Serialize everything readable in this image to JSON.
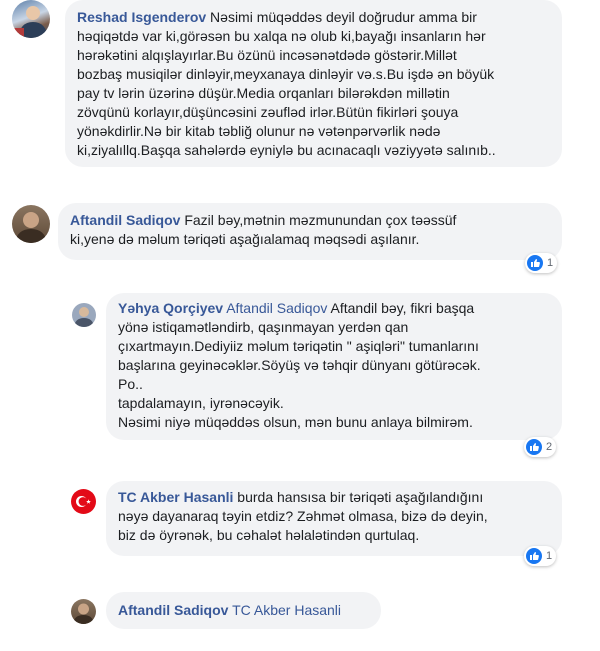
{
  "comments": [
    {
      "author": "Reshad Isgenderov",
      "mention": "",
      "lines": [
        "Nəsimi müqəddəs deyil doğrudur amma bir",
        "həqiqətdə var ki,görəsən bu xalqa nə olub ki,bayağı insanların hər",
        "hərəkətini alqışlayırlar.Bu özünü incəsənətdədə göstərir.Millət",
        "bozbaş musiqilər dinləyir,meyxanaya dinləyir və.s.Bu işdə ən böyük",
        "pay tv lərin üzərinə düşür.Media orqanları bilərəkdən millətin",
        "zövqünü korlayır,düşüncəsini zəufləd irlər.Bütün fikirləri şouya",
        "yönəkdirlir.Nə bir kitab təbliğ olunur nə vətənpərvərlik nədə",
        "ki,ziyalıllq.Başqa sahələrdə eyniylə bu acınacaqlı vəziyyətə salınıb.."
      ],
      "reactions": ""
    },
    {
      "author": "Aftandil Sadiqov",
      "mention": "",
      "lines": [
        "Fazil bəy,mətnin məzmunundan çox təəssüf",
        "ki,yenə də məlum təriqəti aşağıalamaq məqsədi aşılanır."
      ],
      "reactions": "1"
    },
    {
      "author": "Yəhya Qorçiyev",
      "mention": "Aftandil Sadiqov",
      "lines": [
        "Aftandil bəy, fikri başqa",
        "yönə istiqamətləndirb, qaşınmayan yerdən qan",
        "çıxartmayın.Dediyiiz məlum təriqətin \" aşiqləri\" tumanlarını",
        "başlarına geyinəcəklər.Söyüş və təhqir dünyanı götürəcək.",
        "Po..",
        "tapdalamayın, iyrənəcəyik.",
        "Nəsimi niyə müqəddəs olsun, mən bunu anlaya bilmirəm."
      ],
      "reactions": "2"
    },
    {
      "author": "TC Akber Hasanli",
      "mention": "",
      "lines": [
        "burda hansısa bir təriqəti aşağılandığını",
        "nəyə dayanaraq təyin etdiz? Zəhmət olmasa, bizə də deyin,",
        "biz də öyrənək, bu cəhalət həlalətindən qurtulaq."
      ],
      "reactions": "1"
    },
    {
      "author": "Aftandil Sadiqov",
      "mention": "TC Akber Hasanli",
      "lines": [],
      "reactions": ""
    }
  ],
  "icons": {
    "like": "like-thumb-icon",
    "flag": "turkey-flag-icon"
  },
  "colors": {
    "link": "#385898",
    "bubble": "#f2f3f5",
    "like": "#1877f2",
    "flag": "#e30a17"
  }
}
